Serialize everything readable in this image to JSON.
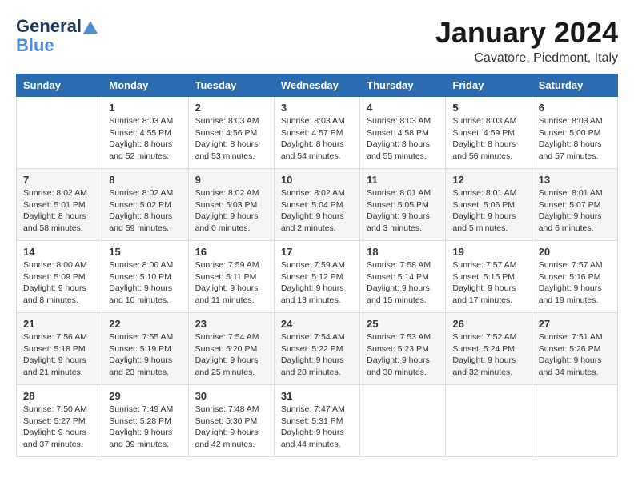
{
  "header": {
    "logo_general": "General",
    "logo_blue": "Blue",
    "month_title": "January 2024",
    "location": "Cavatore, Piedmont, Italy"
  },
  "days_of_week": [
    "Sunday",
    "Monday",
    "Tuesday",
    "Wednesday",
    "Thursday",
    "Friday",
    "Saturday"
  ],
  "weeks": [
    [
      {
        "day": "",
        "sunrise": "",
        "sunset": "",
        "daylight": ""
      },
      {
        "day": "1",
        "sunrise": "Sunrise: 8:03 AM",
        "sunset": "Sunset: 4:55 PM",
        "daylight": "Daylight: 8 hours and 52 minutes."
      },
      {
        "day": "2",
        "sunrise": "Sunrise: 8:03 AM",
        "sunset": "Sunset: 4:56 PM",
        "daylight": "Daylight: 8 hours and 53 minutes."
      },
      {
        "day": "3",
        "sunrise": "Sunrise: 8:03 AM",
        "sunset": "Sunset: 4:57 PM",
        "daylight": "Daylight: 8 hours and 54 minutes."
      },
      {
        "day": "4",
        "sunrise": "Sunrise: 8:03 AM",
        "sunset": "Sunset: 4:58 PM",
        "daylight": "Daylight: 8 hours and 55 minutes."
      },
      {
        "day": "5",
        "sunrise": "Sunrise: 8:03 AM",
        "sunset": "Sunset: 4:59 PM",
        "daylight": "Daylight: 8 hours and 56 minutes."
      },
      {
        "day": "6",
        "sunrise": "Sunrise: 8:03 AM",
        "sunset": "Sunset: 5:00 PM",
        "daylight": "Daylight: 8 hours and 57 minutes."
      }
    ],
    [
      {
        "day": "7",
        "sunrise": "Sunrise: 8:02 AM",
        "sunset": "Sunset: 5:01 PM",
        "daylight": "Daylight: 8 hours and 58 minutes."
      },
      {
        "day": "8",
        "sunrise": "Sunrise: 8:02 AM",
        "sunset": "Sunset: 5:02 PM",
        "daylight": "Daylight: 8 hours and 59 minutes."
      },
      {
        "day": "9",
        "sunrise": "Sunrise: 8:02 AM",
        "sunset": "Sunset: 5:03 PM",
        "daylight": "Daylight: 9 hours and 0 minutes."
      },
      {
        "day": "10",
        "sunrise": "Sunrise: 8:02 AM",
        "sunset": "Sunset: 5:04 PM",
        "daylight": "Daylight: 9 hours and 2 minutes."
      },
      {
        "day": "11",
        "sunrise": "Sunrise: 8:01 AM",
        "sunset": "Sunset: 5:05 PM",
        "daylight": "Daylight: 9 hours and 3 minutes."
      },
      {
        "day": "12",
        "sunrise": "Sunrise: 8:01 AM",
        "sunset": "Sunset: 5:06 PM",
        "daylight": "Daylight: 9 hours and 5 minutes."
      },
      {
        "day": "13",
        "sunrise": "Sunrise: 8:01 AM",
        "sunset": "Sunset: 5:07 PM",
        "daylight": "Daylight: 9 hours and 6 minutes."
      }
    ],
    [
      {
        "day": "14",
        "sunrise": "Sunrise: 8:00 AM",
        "sunset": "Sunset: 5:09 PM",
        "daylight": "Daylight: 9 hours and 8 minutes."
      },
      {
        "day": "15",
        "sunrise": "Sunrise: 8:00 AM",
        "sunset": "Sunset: 5:10 PM",
        "daylight": "Daylight: 9 hours and 10 minutes."
      },
      {
        "day": "16",
        "sunrise": "Sunrise: 7:59 AM",
        "sunset": "Sunset: 5:11 PM",
        "daylight": "Daylight: 9 hours and 11 minutes."
      },
      {
        "day": "17",
        "sunrise": "Sunrise: 7:59 AM",
        "sunset": "Sunset: 5:12 PM",
        "daylight": "Daylight: 9 hours and 13 minutes."
      },
      {
        "day": "18",
        "sunrise": "Sunrise: 7:58 AM",
        "sunset": "Sunset: 5:14 PM",
        "daylight": "Daylight: 9 hours and 15 minutes."
      },
      {
        "day": "19",
        "sunrise": "Sunrise: 7:57 AM",
        "sunset": "Sunset: 5:15 PM",
        "daylight": "Daylight: 9 hours and 17 minutes."
      },
      {
        "day": "20",
        "sunrise": "Sunrise: 7:57 AM",
        "sunset": "Sunset: 5:16 PM",
        "daylight": "Daylight: 9 hours and 19 minutes."
      }
    ],
    [
      {
        "day": "21",
        "sunrise": "Sunrise: 7:56 AM",
        "sunset": "Sunset: 5:18 PM",
        "daylight": "Daylight: 9 hours and 21 minutes."
      },
      {
        "day": "22",
        "sunrise": "Sunrise: 7:55 AM",
        "sunset": "Sunset: 5:19 PM",
        "daylight": "Daylight: 9 hours and 23 minutes."
      },
      {
        "day": "23",
        "sunrise": "Sunrise: 7:54 AM",
        "sunset": "Sunset: 5:20 PM",
        "daylight": "Daylight: 9 hours and 25 minutes."
      },
      {
        "day": "24",
        "sunrise": "Sunrise: 7:54 AM",
        "sunset": "Sunset: 5:22 PM",
        "daylight": "Daylight: 9 hours and 28 minutes."
      },
      {
        "day": "25",
        "sunrise": "Sunrise: 7:53 AM",
        "sunset": "Sunset: 5:23 PM",
        "daylight": "Daylight: 9 hours and 30 minutes."
      },
      {
        "day": "26",
        "sunrise": "Sunrise: 7:52 AM",
        "sunset": "Sunset: 5:24 PM",
        "daylight": "Daylight: 9 hours and 32 minutes."
      },
      {
        "day": "27",
        "sunrise": "Sunrise: 7:51 AM",
        "sunset": "Sunset: 5:26 PM",
        "daylight": "Daylight: 9 hours and 34 minutes."
      }
    ],
    [
      {
        "day": "28",
        "sunrise": "Sunrise: 7:50 AM",
        "sunset": "Sunset: 5:27 PM",
        "daylight": "Daylight: 9 hours and 37 minutes."
      },
      {
        "day": "29",
        "sunrise": "Sunrise: 7:49 AM",
        "sunset": "Sunset: 5:28 PM",
        "daylight": "Daylight: 9 hours and 39 minutes."
      },
      {
        "day": "30",
        "sunrise": "Sunrise: 7:48 AM",
        "sunset": "Sunset: 5:30 PM",
        "daylight": "Daylight: 9 hours and 42 minutes."
      },
      {
        "day": "31",
        "sunrise": "Sunrise: 7:47 AM",
        "sunset": "Sunset: 5:31 PM",
        "daylight": "Daylight: 9 hours and 44 minutes."
      },
      {
        "day": "",
        "sunrise": "",
        "sunset": "",
        "daylight": ""
      },
      {
        "day": "",
        "sunrise": "",
        "sunset": "",
        "daylight": ""
      },
      {
        "day": "",
        "sunrise": "",
        "sunset": "",
        "daylight": ""
      }
    ]
  ]
}
